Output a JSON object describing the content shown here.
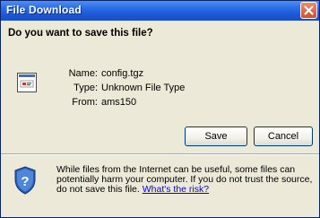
{
  "window": {
    "title": "File Download"
  },
  "dialog": {
    "question": "Do you want to save this file?",
    "name_label": "Name:",
    "name_value": "config.tgz",
    "type_label": "Type:",
    "type_value": "Unknown File Type",
    "from_label": "From:",
    "from_value": "ams150",
    "save_label": "Save",
    "cancel_label": "Cancel",
    "warning_text": "While files from the Internet can be useful, some files can potentially harm your computer. If you do not trust the source, do not save this file.",
    "warning_link": "What's the risk?"
  },
  "icons": {
    "file": "file-icon",
    "shield": "shield-icon",
    "close": "close-icon"
  }
}
